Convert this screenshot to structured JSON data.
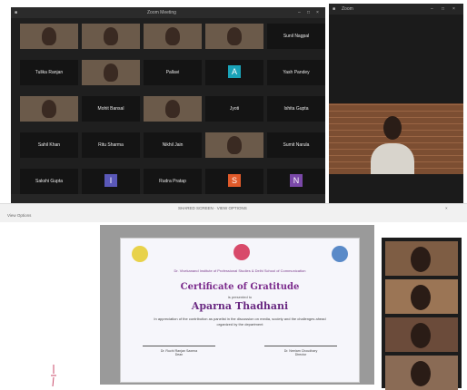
{
  "zoom_main": {
    "title": "Zoom Meeting",
    "grid": [
      {
        "label": "",
        "type": "video"
      },
      {
        "label": "",
        "type": "video"
      },
      {
        "label": "",
        "type": "video"
      },
      {
        "label": "",
        "type": "video"
      },
      {
        "label": "",
        "name": "Sunil Nagpal"
      },
      {
        "label": "",
        "name": "Tulika Ranjan"
      },
      {
        "label": "",
        "type": "video"
      },
      {
        "label": "",
        "name": "Pallavi"
      },
      {
        "label": "",
        "avatar": "A",
        "avatar_color": "#1aa3b8"
      },
      {
        "label": "",
        "name": "Yash Pandey"
      },
      {
        "label": "",
        "type": "video"
      },
      {
        "label": "",
        "name": "Mohit Bansal"
      },
      {
        "label": "",
        "type": "video"
      },
      {
        "label": "",
        "name": "Jyoti"
      },
      {
        "label": "",
        "name": "Ishita Gupta"
      },
      {
        "label": "",
        "name": "Sahil Khan"
      },
      {
        "label": "",
        "name": "Ritu Sharma"
      },
      {
        "label": "",
        "name": "Nikhil Jain"
      },
      {
        "label": "",
        "type": "video"
      },
      {
        "label": "",
        "name": "Sumit Narula"
      },
      {
        "label": "",
        "name": "Sakshi Gupta"
      },
      {
        "label": "",
        "avatar": "I",
        "avatar_color": "#5a58b8"
      },
      {
        "label": "",
        "name": "Rudra Pratap"
      },
      {
        "label": "",
        "avatar": "S",
        "avatar_color": "#e05a2a"
      },
      {
        "label": "",
        "avatar": "N",
        "avatar_color": "#7a48a8"
      }
    ]
  },
  "zoom_side": {
    "title": "Zoom"
  },
  "browser": {
    "tab_text": "SHARED SCREEN · VIEW OPTIONS",
    "toolbar_text": "View Options"
  },
  "certificate": {
    "banner": "Dr. Vivekanand Institute of Professional Studies & Delhi School of Communication",
    "title": "Certificate of Gratitude",
    "presented": "is presented to",
    "recipient": "Aparna Thadhani",
    "body": "In appreciation of the contribution as panelist in the discussion on media, society and the challenges ahead organized by the department",
    "sig_left": "Dr. Ruchi Ranjan Saxena",
    "sig_left_role": "Dean",
    "sig_right": "Dr. Neelam Choudhary",
    "sig_right_role": "Director"
  },
  "colors": {
    "cert_title": "#7b2a8c",
    "zoom_bg": "#1f1f1f"
  }
}
